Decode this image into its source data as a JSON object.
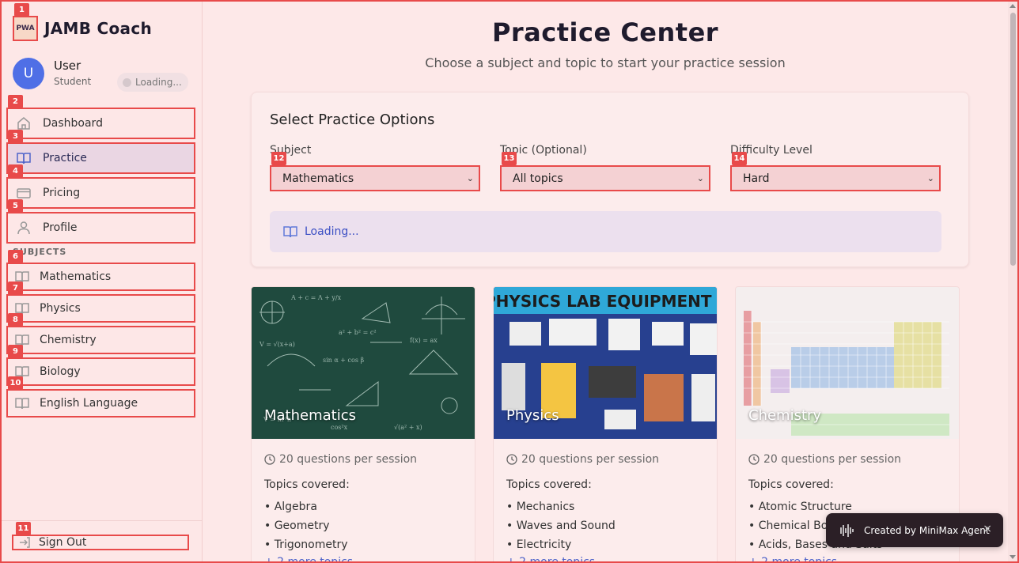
{
  "app": {
    "name": "JAMB Coach",
    "logo_text": "PWA"
  },
  "user": {
    "avatar_letter": "U",
    "name": "User",
    "role": "Student",
    "status": "Loading..."
  },
  "nav": [
    {
      "label": "Dashboard",
      "icon": "home-icon"
    },
    {
      "label": "Practice",
      "icon": "book-icon",
      "active": true
    },
    {
      "label": "Pricing",
      "icon": "credit-card-icon"
    },
    {
      "label": "Profile",
      "icon": "user-icon"
    }
  ],
  "subjects_heading": "SUBJECTS",
  "subjects_nav": [
    "Mathematics",
    "Physics",
    "Chemistry",
    "Biology",
    "English Language"
  ],
  "sign_out": "Sign Out",
  "markers": [
    "1",
    "2",
    "3",
    "4",
    "5",
    "6",
    "7",
    "8",
    "9",
    "10",
    "11",
    "12",
    "13",
    "14"
  ],
  "header": {
    "title": "Practice Center",
    "subtitle": "Choose a subject and topic to start your practice session"
  },
  "options": {
    "title": "Select Practice Options",
    "subject_label": "Subject",
    "subject_value": "Mathematics",
    "topic_label": "Topic (Optional)",
    "topic_value": "All topics",
    "difficulty_label": "Difficulty Level",
    "difficulty_value": "Hard",
    "loading_text": "Loading..."
  },
  "cards": [
    {
      "title": "Mathematics",
      "questions": "20 questions per session",
      "topics_label": "Topics covered:",
      "topics": [
        "• Algebra",
        "• Geometry",
        "• Trigonometry"
      ],
      "more": "+ 2 more topics"
    },
    {
      "title": "Physics",
      "questions": "20 questions per session",
      "topics_label": "Topics covered:",
      "topics": [
        "• Mechanics",
        "• Waves and Sound",
        "• Electricity"
      ],
      "more": "+ 2 more topics"
    },
    {
      "title": "Chemistry",
      "questions": "20 questions per session",
      "topics_label": "Topics covered:",
      "topics": [
        "• Atomic Structure",
        "• Chemical Bo",
        "• Acids, Bases and Salts"
      ],
      "more": "+ 2 more topics"
    }
  ],
  "physics_banner": "PHYSICS LAB EQUIPMENT",
  "toast": {
    "text": "Created by MiniMax Agent",
    "close": "×"
  },
  "colors": {
    "accent": "#e84a4a",
    "primary": "#4e63c9",
    "background": "#fde8e8"
  }
}
